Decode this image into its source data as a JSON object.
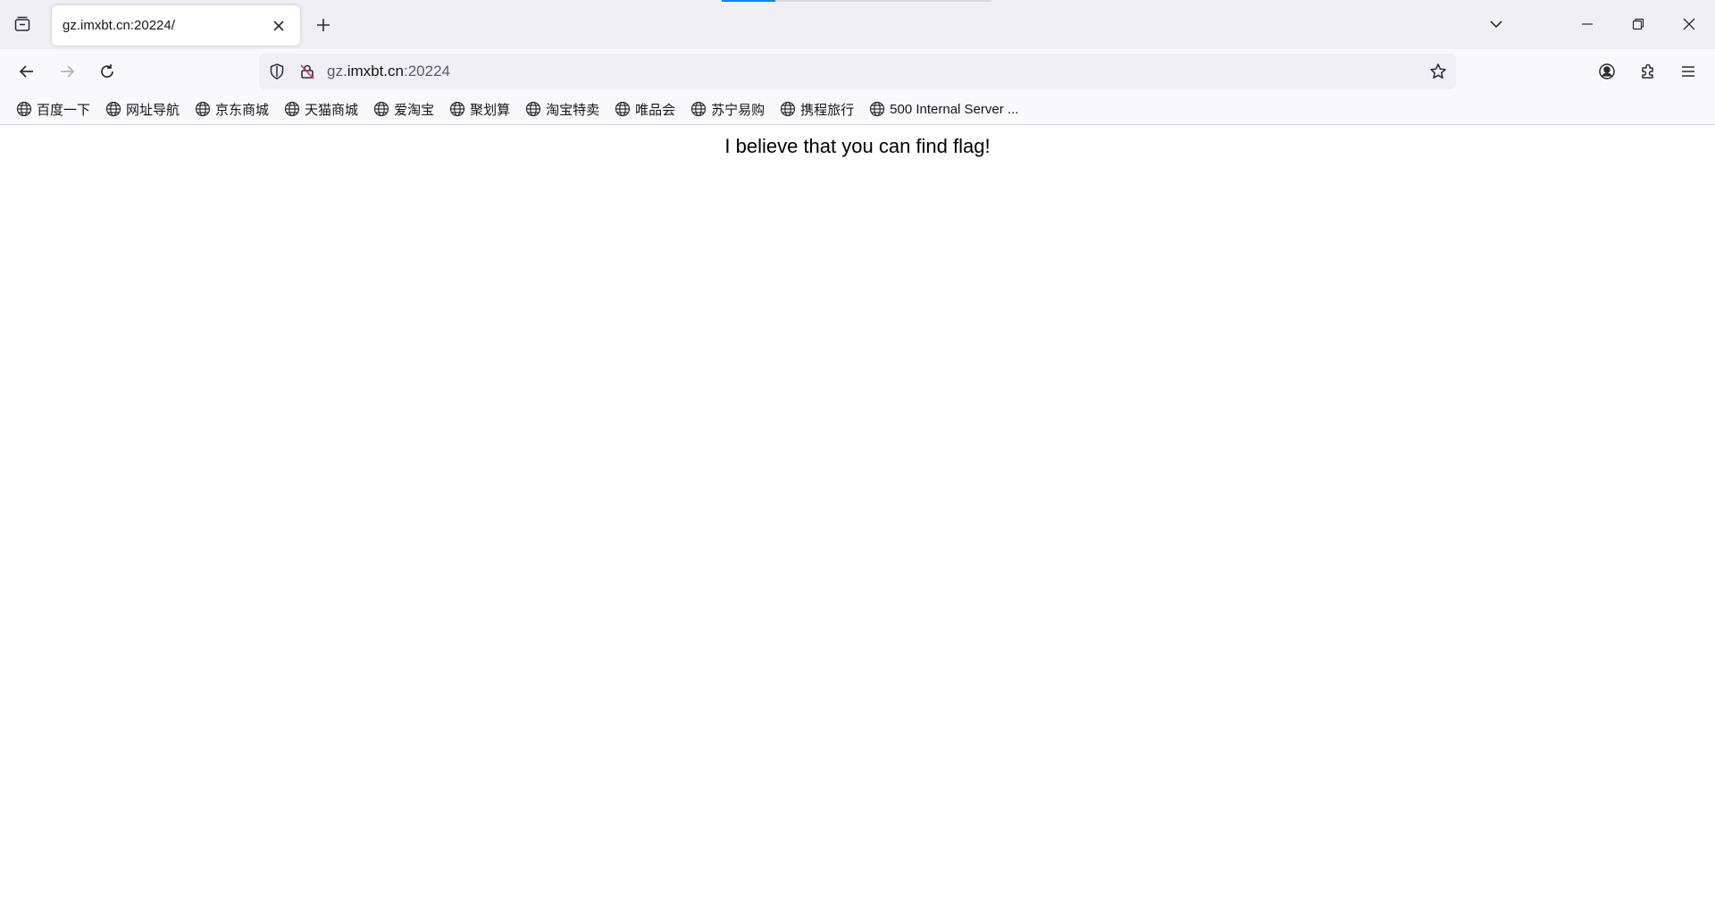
{
  "tab": {
    "title": "gz.imxbt.cn:20224/"
  },
  "url": {
    "prefix": "gz.",
    "host": "imxbt.cn",
    "port": ":20224"
  },
  "bookmarks": [
    {
      "label": "百度一下"
    },
    {
      "label": "网址导航"
    },
    {
      "label": "京东商城"
    },
    {
      "label": "天猫商城"
    },
    {
      "label": "爱淘宝"
    },
    {
      "label": "聚划算"
    },
    {
      "label": "淘宝特卖"
    },
    {
      "label": "唯品会"
    },
    {
      "label": "苏宁易购"
    },
    {
      "label": "携程旅行"
    },
    {
      "label": "500 Internal Server ..."
    }
  ],
  "page": {
    "message": "I believe that you can find flag!"
  },
  "icons": {
    "tab_list": "tab-list-icon",
    "close": "close-icon",
    "new_tab": "plus-icon",
    "all_tabs": "chevron-down-icon",
    "minimize": "minimize-icon",
    "restore": "restore-icon",
    "back": "back-arrow-icon",
    "forward": "forward-arrow-icon",
    "reload": "reload-icon",
    "shield": "shield-icon",
    "insecure": "insecure-lock-icon",
    "star": "star-icon",
    "account": "account-icon",
    "extensions": "puzzle-icon",
    "menu": "hamburger-menu-icon",
    "bookmark": "globe-icon"
  },
  "colors": {
    "chrome": "#f0f0f4",
    "toolbar": "#f9f9fb",
    "accent": "#0a84ff",
    "insecure": "#e22850"
  }
}
